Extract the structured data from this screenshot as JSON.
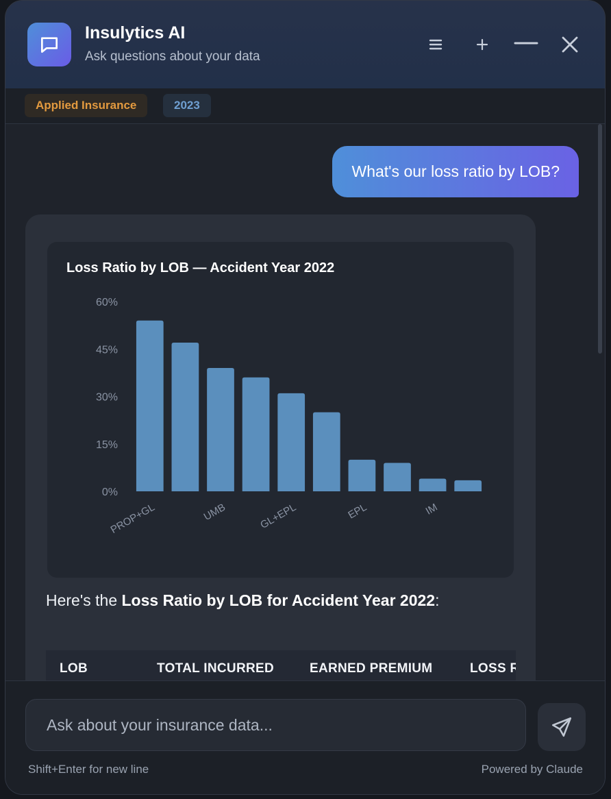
{
  "app": {
    "title": "Insulytics AI",
    "subtitle": "Ask questions about your data"
  },
  "header": {
    "buttons": [
      "menu-icon",
      "plus-icon",
      "minimize-icon",
      "close-icon"
    ]
  },
  "filters": {
    "company": "Applied Insurance",
    "year": "2023"
  },
  "conversation": {
    "user_message": "What's our loss ratio by LOB?",
    "reply_prefix": "Here's the ",
    "reply_bold": "Loss Ratio by LOB for Accident Year 2022",
    "reply_suffix": ":"
  },
  "chart_data": {
    "type": "bar",
    "title": "Loss Ratio by LOB — Accident Year 2022",
    "xlabel": "",
    "ylabel": "",
    "categories": [
      "PROP+GL",
      "",
      "UMB",
      "",
      "GL+EPL",
      "",
      "EPL",
      "",
      "IM",
      ""
    ],
    "values": [
      54,
      47,
      39,
      36,
      31,
      25,
      10,
      9,
      4,
      3.5
    ],
    "ylim": [
      0,
      60
    ],
    "yticks": [
      "0%",
      "15%",
      "30%",
      "45%",
      "60%"
    ],
    "ytick_values": [
      0,
      15,
      30,
      45,
      60
    ],
    "bar_color": "#5b8fbd",
    "grid": false
  },
  "table": {
    "headers": [
      "LOB",
      "TOTAL INCURRED",
      "EARNED PREMIUM",
      "LOSS RATIO"
    ]
  },
  "composer": {
    "placeholder": "Ask about your insurance data...",
    "hint": "Shift+Enter for new line",
    "powered_by": "Powered by Claude"
  },
  "colors": {
    "accent_gradient_start": "#4f8fd9",
    "accent_gradient_end": "#6a62e4",
    "company_chip": "#e39a3f",
    "year_chip": "#6f9fd1"
  }
}
